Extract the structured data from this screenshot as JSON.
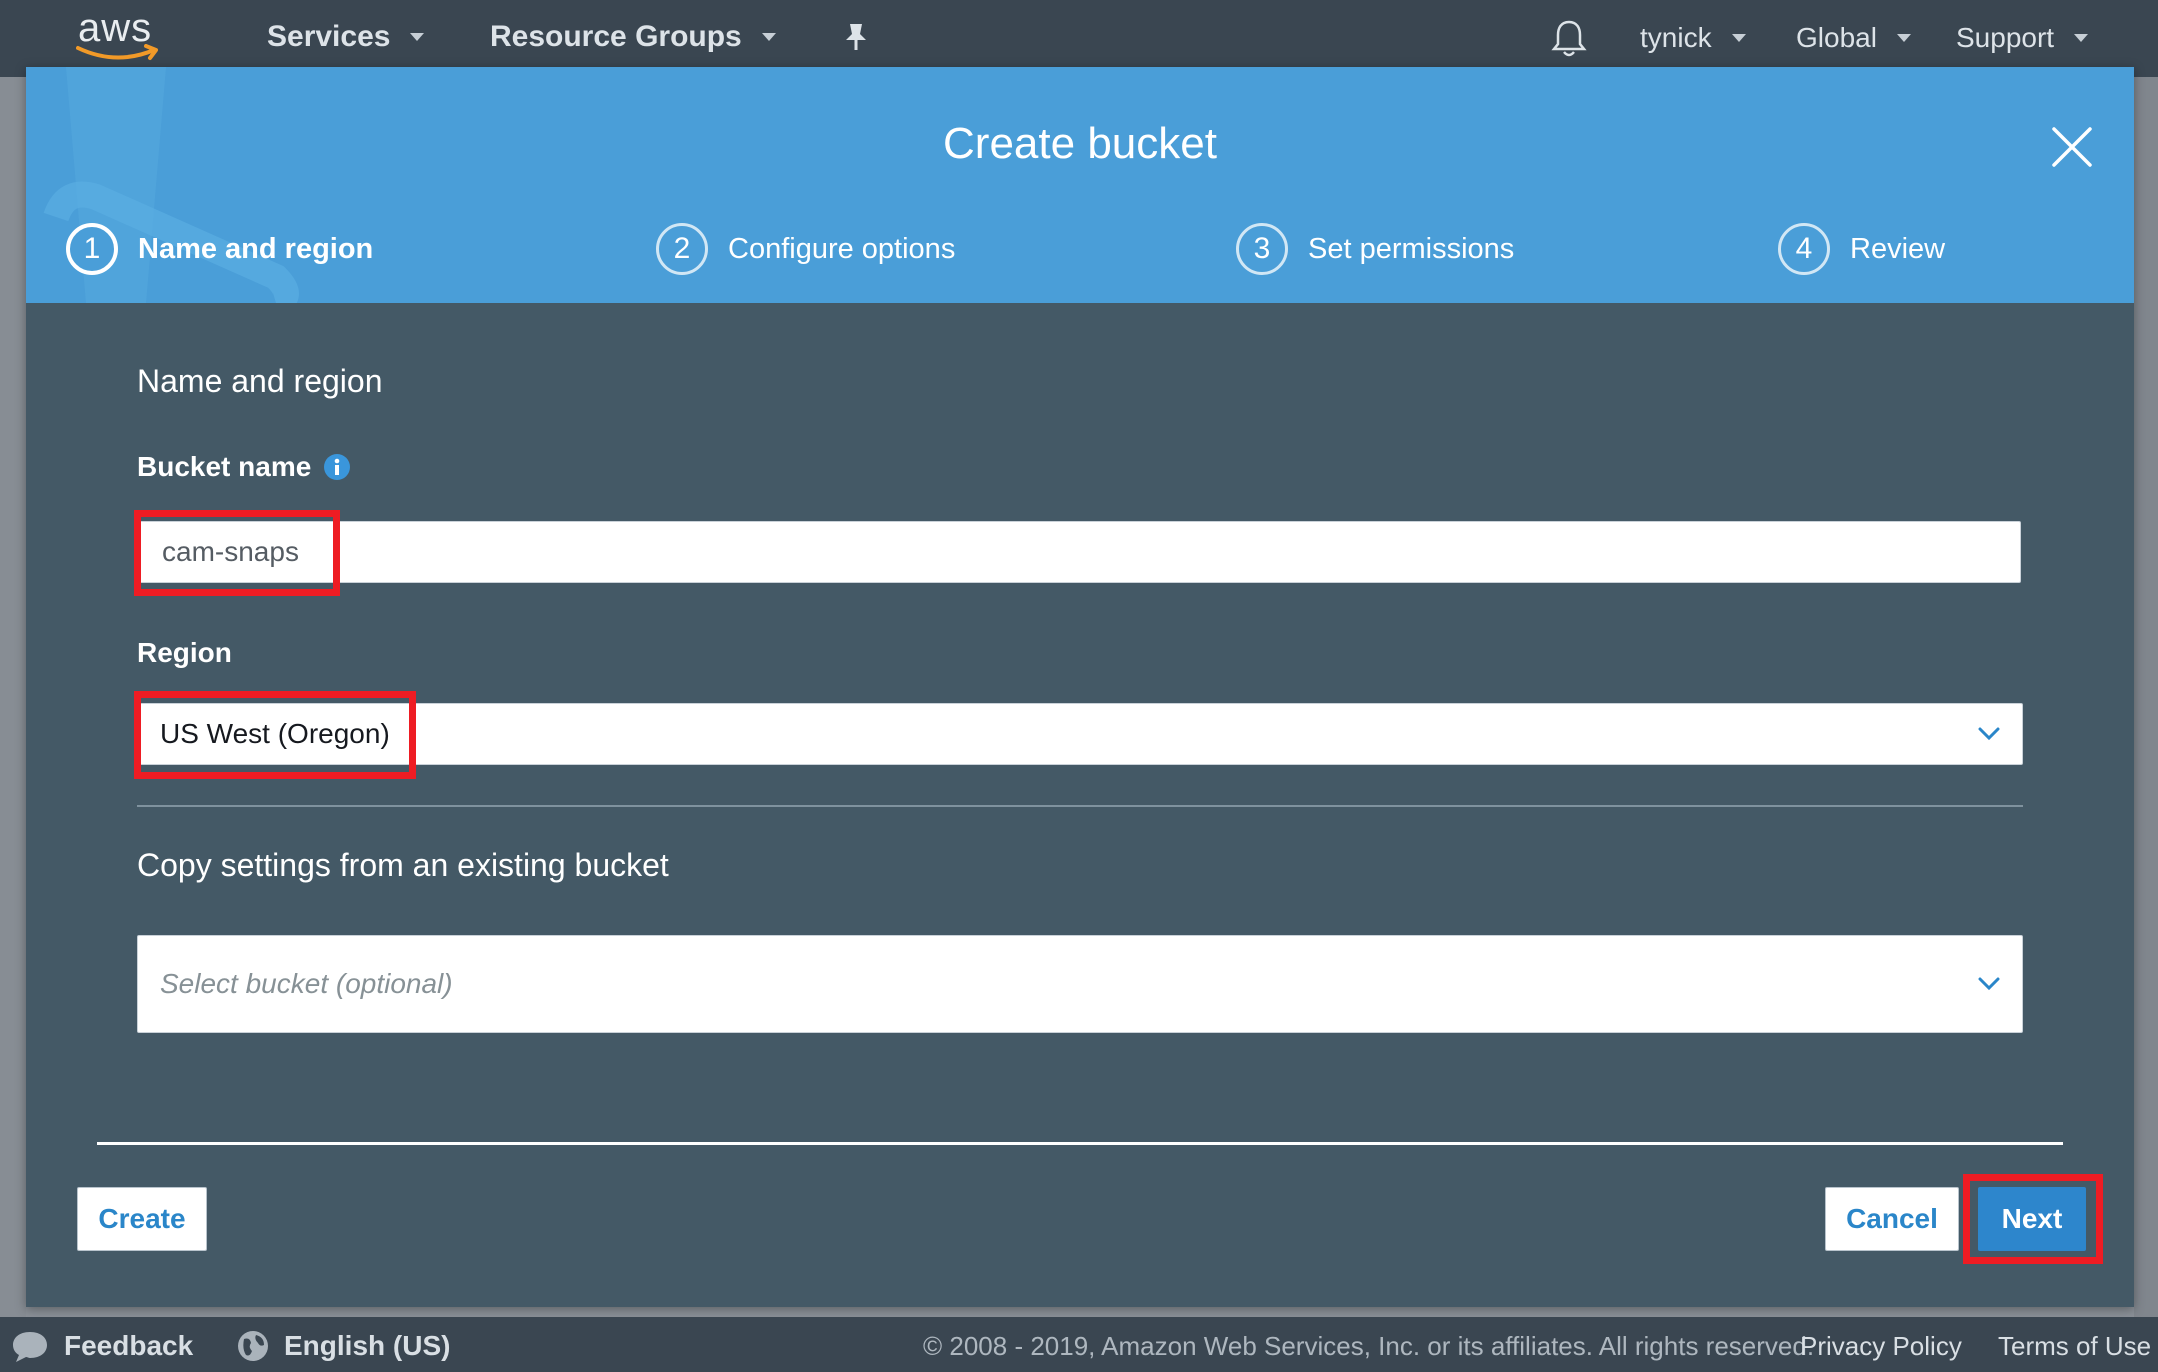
{
  "topnav": {
    "logo_text": "aws",
    "services": "Services",
    "resource_groups": "Resource Groups",
    "user": "tynick",
    "region": "Global",
    "support": "Support"
  },
  "modal": {
    "title": "Create bucket",
    "steps": [
      {
        "number": "1",
        "label": "Name and region",
        "active": true
      },
      {
        "number": "2",
        "label": "Configure options",
        "active": false
      },
      {
        "number": "3",
        "label": "Set permissions",
        "active": false
      },
      {
        "number": "4",
        "label": "Review",
        "active": false
      }
    ],
    "section_title": "Name and region",
    "bucket_name_label": "Bucket name",
    "bucket_name_value": "cam-snaps",
    "region_label": "Region",
    "region_value": "US West (Oregon)",
    "copy_settings_title": "Copy settings from an existing bucket",
    "copy_settings_placeholder": "Select bucket (optional)",
    "create_button": "Create",
    "cancel_button": "Cancel",
    "next_button": "Next"
  },
  "footer": {
    "feedback": "Feedback",
    "language": "English (US)",
    "copyright": "© 2008 - 2019, Amazon Web Services, Inc. or its affiliates. All rights reserved.",
    "privacy": "Privacy Policy",
    "terms": "Terms of Use"
  },
  "colors": {
    "header_blue": "#4a9ed8",
    "modal_body": "#445966",
    "highlight_red": "#ee1c23",
    "primary_button": "#2d86cc"
  }
}
